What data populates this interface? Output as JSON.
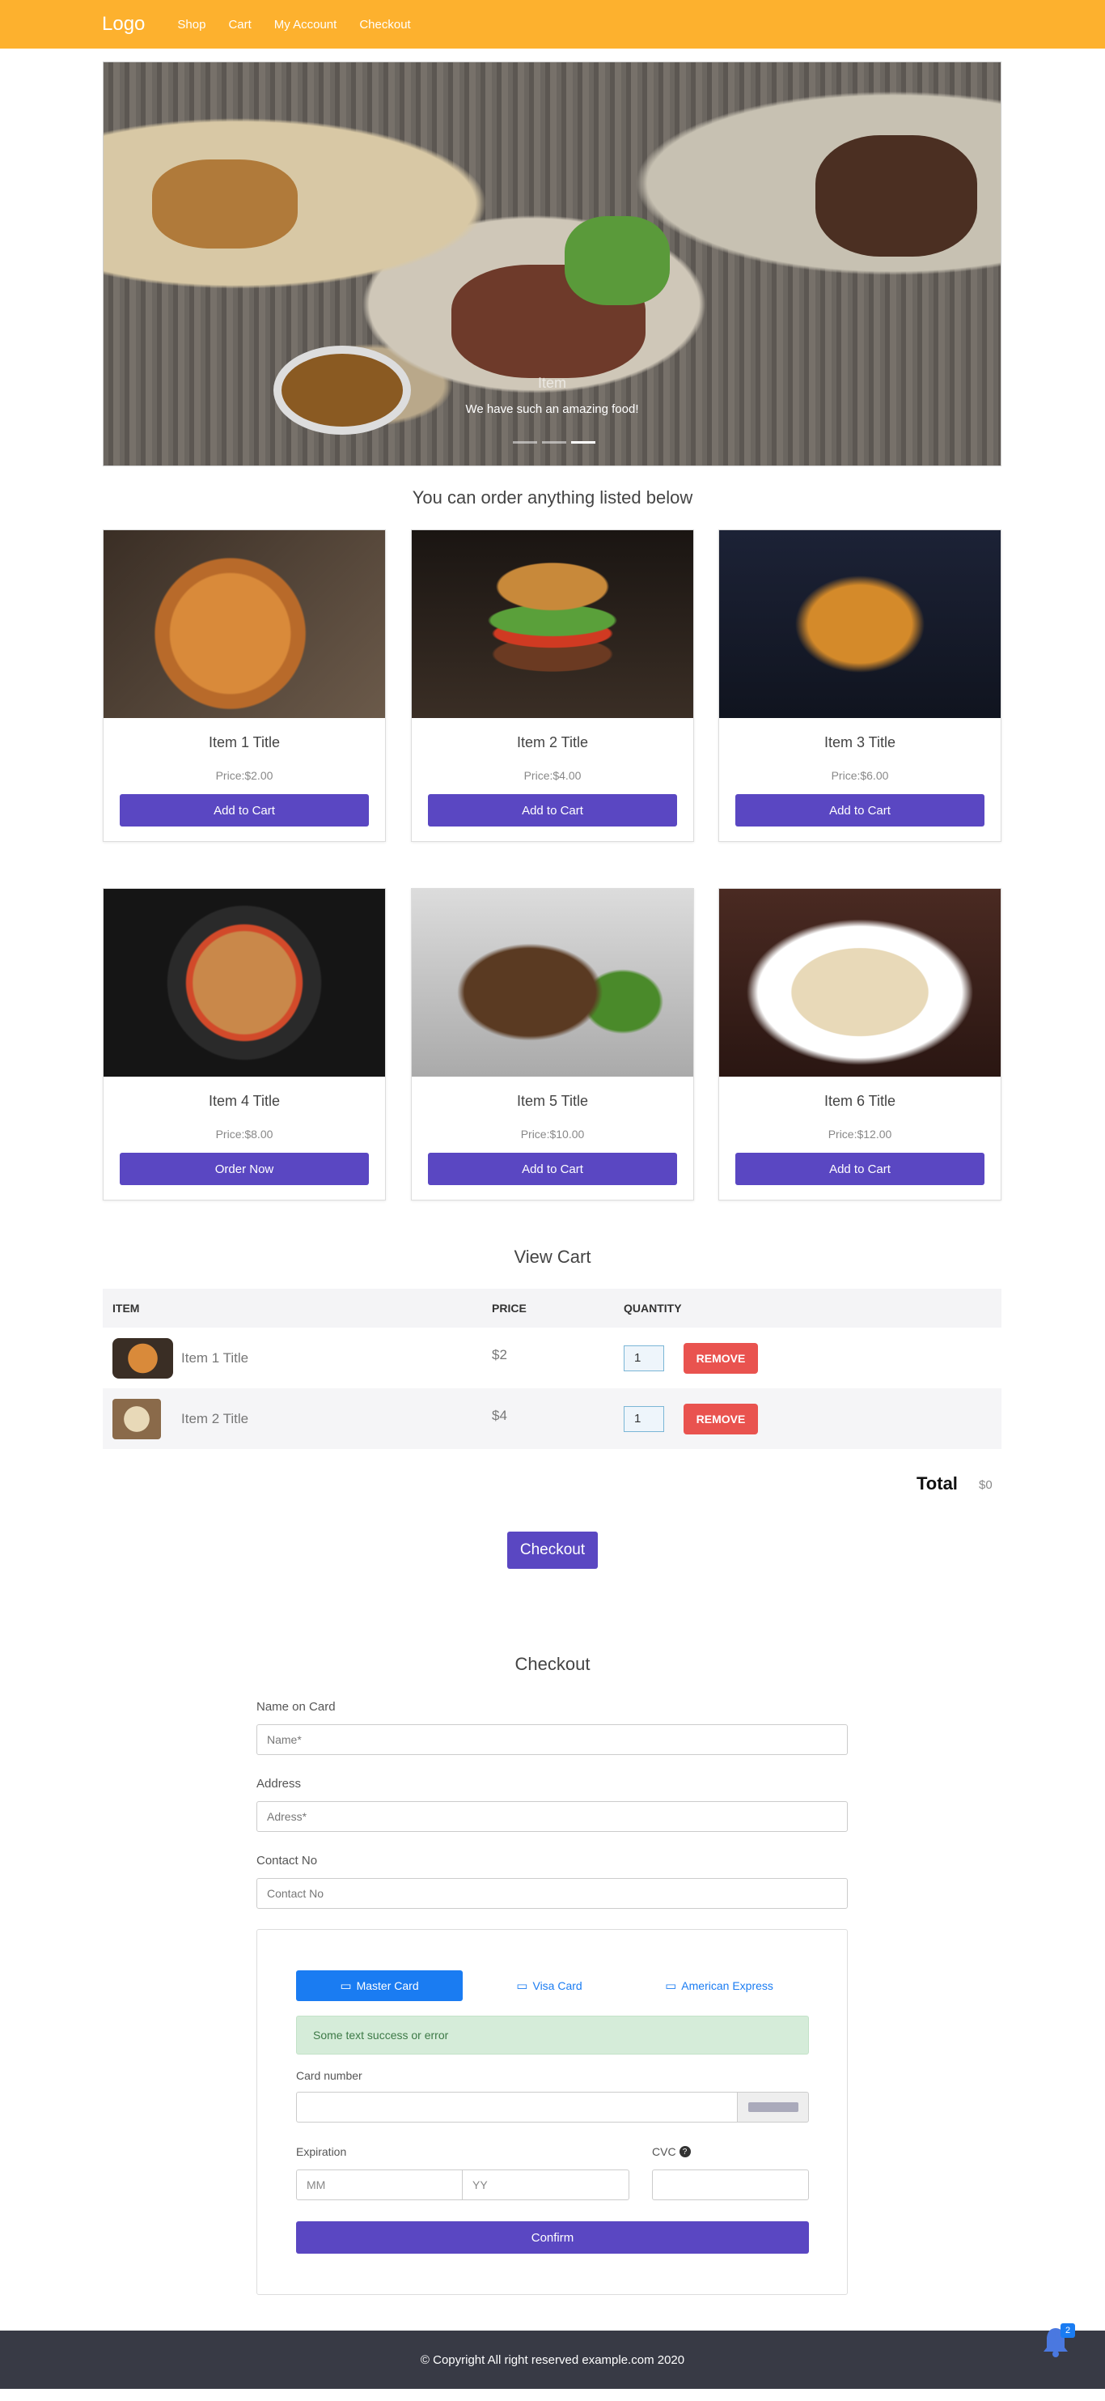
{
  "nav": {
    "logo": "Logo",
    "links": [
      "Shop",
      "Cart",
      "My Account",
      "Checkout"
    ]
  },
  "hero": {
    "caption_title": "Item",
    "caption_text": "We have such an amazing food!",
    "slides": 3,
    "active_slide": 3
  },
  "menu": {
    "heading": "You can order anything listed below",
    "items": [
      {
        "title": "Item 1 Title",
        "price": "Price:$2.00",
        "button": "Add to Cart",
        "image": "pizza"
      },
      {
        "title": "Item 2 Title",
        "price": "Price:$4.00",
        "button": "Add to Cart",
        "image": "burger"
      },
      {
        "title": "Item 3 Title",
        "price": "Price:$6.00",
        "button": "Add to Cart",
        "image": "fries"
      },
      {
        "title": "Item 4 Title",
        "price": "Price:$8.00",
        "button": "Order Now",
        "image": "pasta"
      },
      {
        "title": "Item 5 Title",
        "price": "Price:$10.00",
        "button": "Add to Cart",
        "image": "steak"
      },
      {
        "title": "Item 6 Title",
        "price": "Price:$12.00",
        "button": "Add to Cart",
        "image": "salad"
      }
    ]
  },
  "cart": {
    "heading": "View Cart",
    "columns": [
      "ITEM",
      "PRICE",
      "QUANTITY"
    ],
    "rows": [
      {
        "title": "Item 1 Title",
        "price": "$2",
        "qty": "1",
        "remove": "REMOVE"
      },
      {
        "title": "Item 2 Title",
        "price": "$4",
        "qty": "1",
        "remove": "REMOVE"
      }
    ],
    "total_label": "Total",
    "total_value": "$0",
    "checkout_button": "Checkout"
  },
  "checkout": {
    "heading": "Checkout",
    "name_label": "Name on Card",
    "name_placeholder": "Name*",
    "address_label": "Address",
    "address_placeholder": "Adress*",
    "contact_label": "Contact No",
    "contact_placeholder": "Contact No",
    "tabs": [
      "Master Card",
      "Visa Card",
      "American Express"
    ],
    "active_tab": "Master Card",
    "message": "Some text success or error",
    "card_number_label": "Card number",
    "expiration_label": "Expiration",
    "mm_placeholder": "MM",
    "yy_placeholder": "YY",
    "cvc_label": "CVC",
    "confirm_button": "Confirm"
  },
  "footer": {
    "text": "© Copyright All right reserved example.com 2020"
  },
  "notifications": {
    "count": "2"
  },
  "colors": {
    "nav": "#FDB12E",
    "primary": "#5a47c2",
    "remove": "#e9534f",
    "footer": "#383a45",
    "tab_active": "#1a7cf2"
  }
}
